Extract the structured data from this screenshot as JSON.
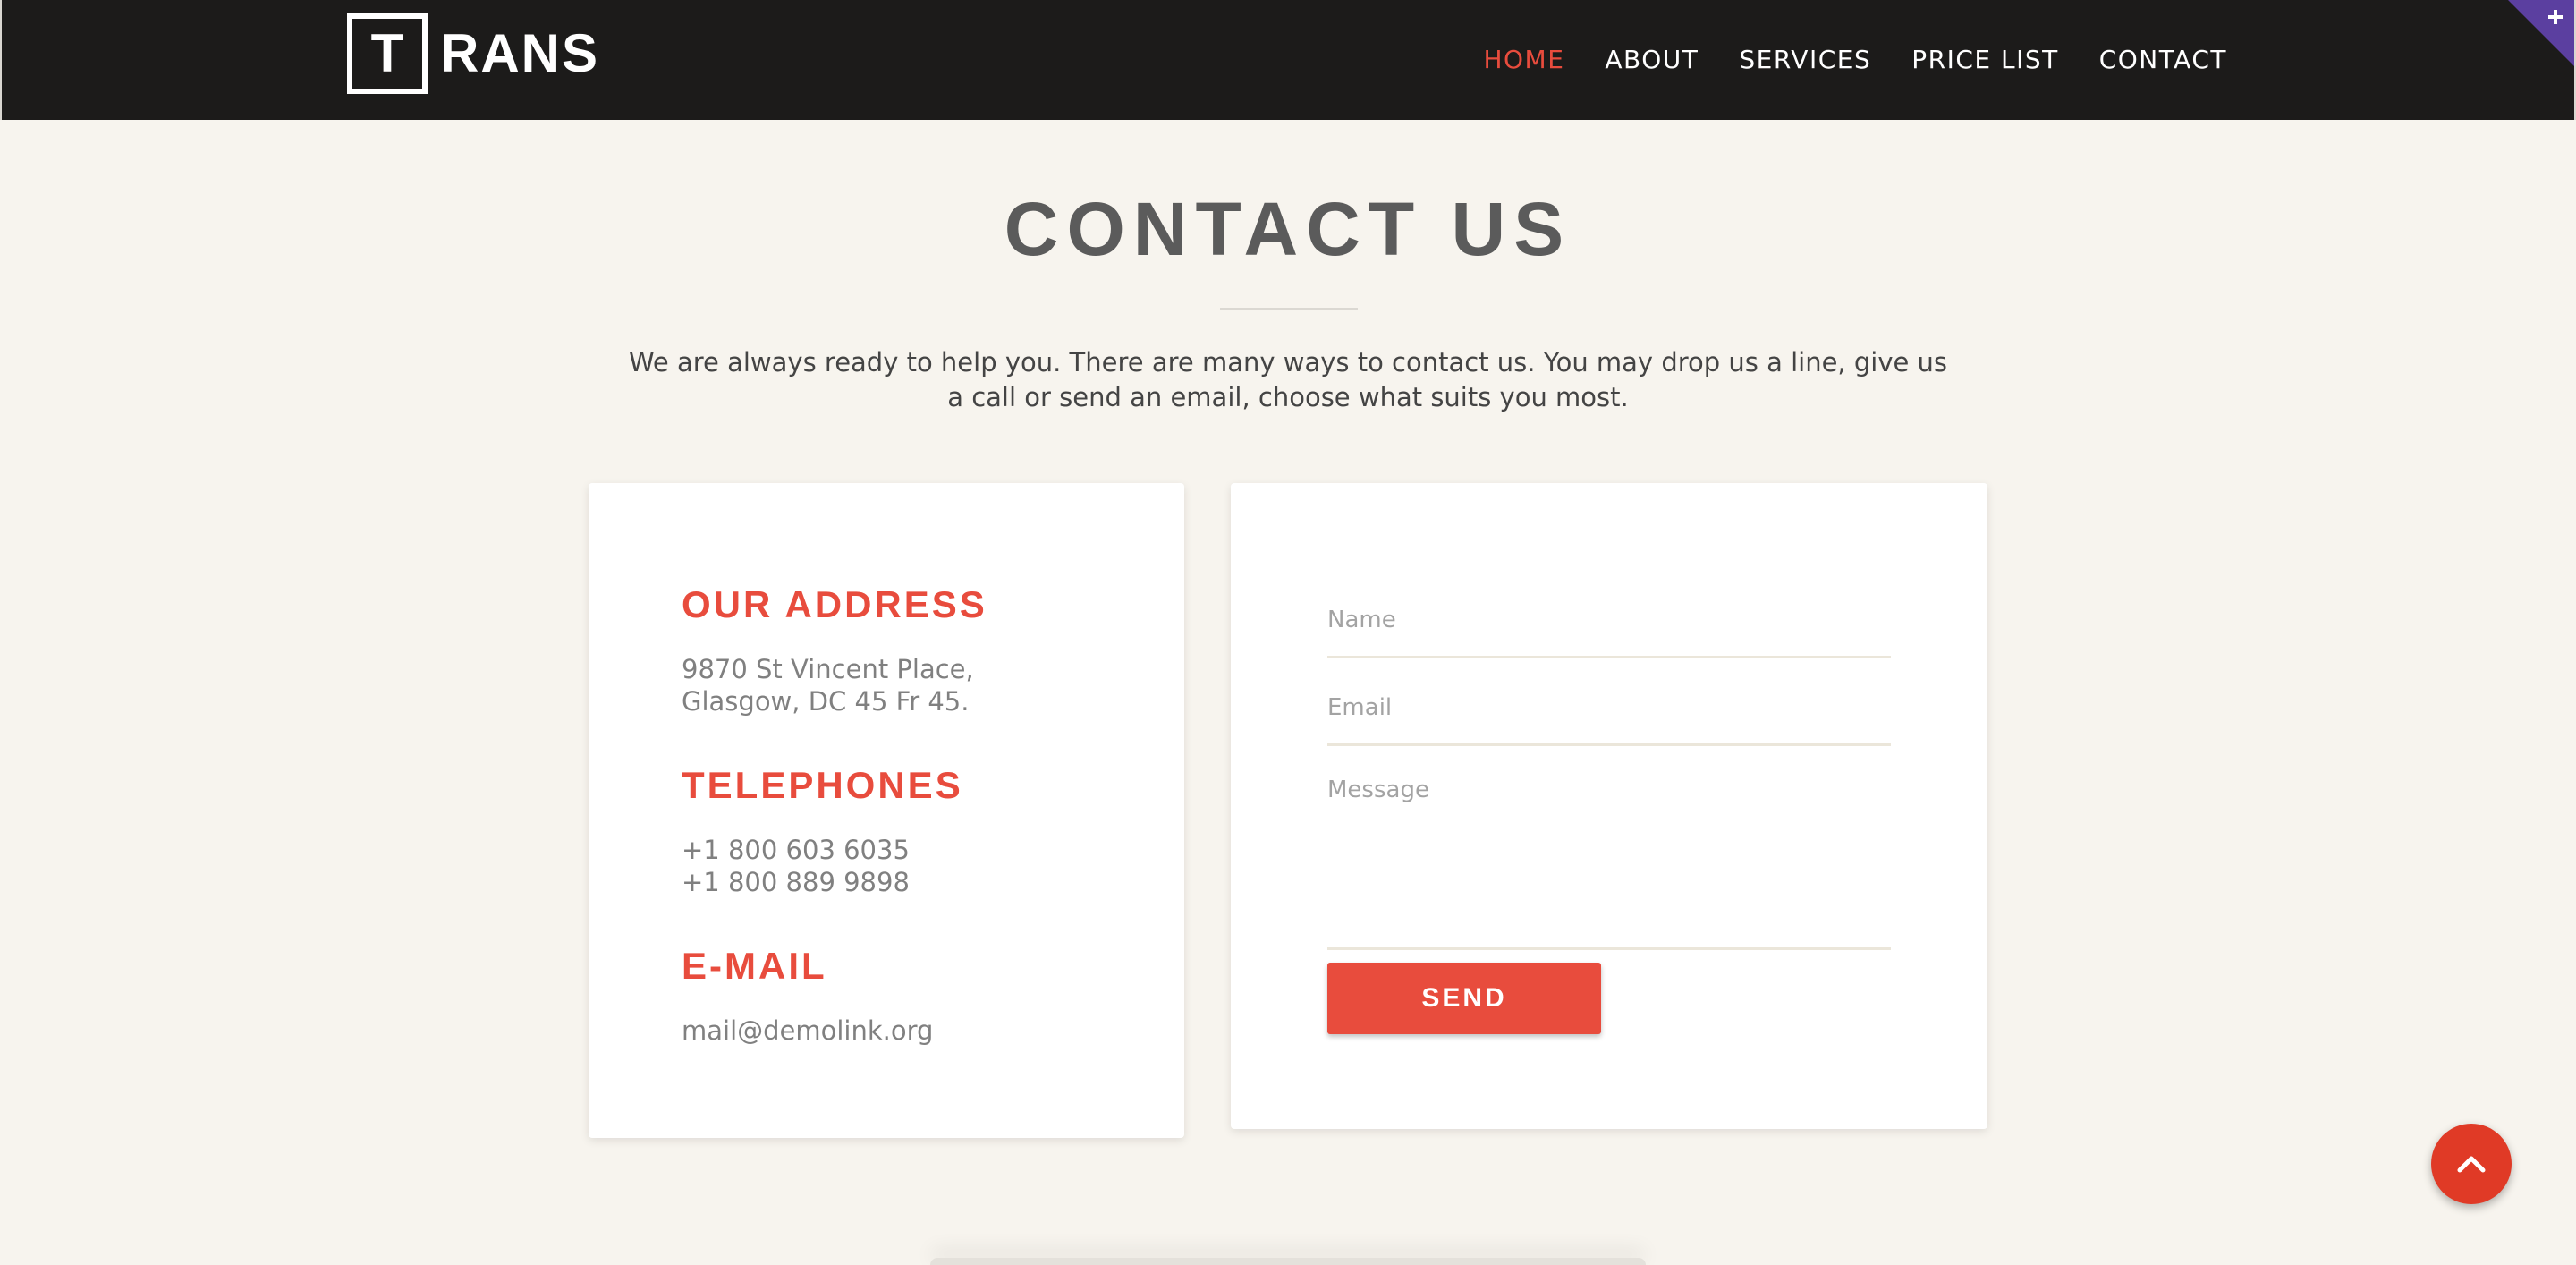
{
  "header": {
    "logo": {
      "boxed_letter": "T",
      "rest": "RANS"
    },
    "nav": [
      {
        "label": "HOME",
        "active": true
      },
      {
        "label": "ABOUT",
        "active": false
      },
      {
        "label": "SERVICES",
        "active": false
      },
      {
        "label": "PRICE LIST",
        "active": false
      },
      {
        "label": "CONTACT",
        "active": false
      }
    ]
  },
  "main": {
    "title": "CONTACT US",
    "intro": "We are always ready to help you. There are many ways to contact us. You may drop us a line, give us a call or send an email, choose what suits you most."
  },
  "contact_info": {
    "address_title": "OUR ADDRESS",
    "address_lines": [
      "9870 St Vincent Place,",
      "Glasgow, DC 45 Fr 45."
    ],
    "phones_title": "TELEPHONES",
    "phones": [
      "+1 800 603 6035",
      "+1 800 889 9898"
    ],
    "email_title": "E-MAIL",
    "email": "mail@demolink.org"
  },
  "form": {
    "name_placeholder": "Name",
    "email_placeholder": "Email",
    "message_placeholder": "Message",
    "name_value": "",
    "email_value": "",
    "message_value": "",
    "send_label": "SEND"
  },
  "colors": {
    "accent": "#e84c3d",
    "header_bg": "#1c1b1a",
    "page_bg": "#f7f4ee",
    "corner_ribbon": "#5b3fa0"
  },
  "icons": {
    "corner": "plus-icon",
    "back_to_top": "chevron-up-icon"
  }
}
